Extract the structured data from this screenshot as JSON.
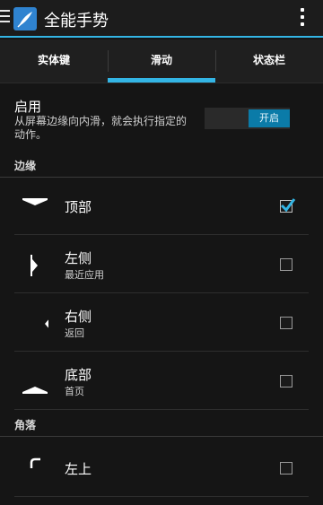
{
  "actionbar": {
    "title": "全能手势"
  },
  "tabs": [
    {
      "label": "实体键",
      "active": false
    },
    {
      "label": "滑动",
      "active": true
    },
    {
      "label": "状态栏",
      "active": false
    }
  ],
  "enable": {
    "title": "启用",
    "description": "从屏幕边缘向内滑，就会执行指定的动作。",
    "switch_label": "开启"
  },
  "sections": {
    "edge": "边缘",
    "corner": "角落"
  },
  "items": [
    {
      "title": "顶部",
      "subtitle": "",
      "checked": true
    },
    {
      "title": "左侧",
      "subtitle": "最近应用",
      "checked": false
    },
    {
      "title": "右侧",
      "subtitle": "返回",
      "checked": false
    },
    {
      "title": "底部",
      "subtitle": "首页",
      "checked": false
    },
    {
      "title": "左上",
      "subtitle": "",
      "checked": false
    }
  ],
  "colors": {
    "accent": "#33b5e5",
    "switch_on": "#0b7ba8",
    "logo": "#2f83d0"
  }
}
